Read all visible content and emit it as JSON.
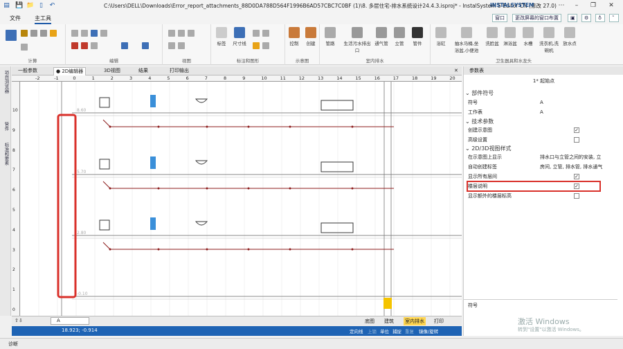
{
  "titlebar": {
    "title": "C:\\Users\\DELL\\Downloads\\Error_report_attachments_88D0DA788D564F1996B6AD57CBC7C0BF (1)\\8. 多层住宅-排水系统设计24.4.3.isproj* - InstalSystem 5 Editor CN (修改 27.0)",
    "brand": "INSTALSYSTEM"
  },
  "menubar": {
    "items": [
      "文件",
      "主工具"
    ],
    "window_btn": "窗口",
    "layout_btn": "更改屏幕的窗口布置"
  },
  "ribbon": {
    "groups": [
      "计算",
      "编辑",
      "视图",
      "标注和图形",
      "示意图",
      "室内排水",
      "卫生器具和水龙头"
    ],
    "big_buttons": [
      "标签",
      "尺寸线",
      "控制",
      "创建",
      "管路",
      "生活污水排出口",
      "通气管",
      "立管",
      "管件",
      "浴缸",
      "抽水马桶,坐浴盆,小便池",
      "洗脸盆",
      "淋浴盆",
      "水槽",
      "洗衣机,洗碗机",
      "放水点"
    ]
  },
  "leftstrip": {
    "tabs": [
      "项目浏览器",
      "管件",
      "标准和要素"
    ]
  },
  "doctabs": {
    "items": [
      "一般参数",
      "● 2D编辑器",
      "3D视图",
      "结果",
      "打印输出"
    ]
  },
  "ruler": {
    "h": [
      "-2",
      "-1",
      "0",
      "1",
      "2",
      "3",
      "4",
      "5",
      "6",
      "7",
      "8",
      "9",
      "10",
      "11",
      "12",
      "13",
      "14",
      "15",
      "16",
      "17",
      "18",
      "19",
      "20"
    ],
    "v": [
      "10",
      "9",
      "8",
      "7",
      "6",
      "5",
      "4",
      "3",
      "2",
      "1",
      "0"
    ]
  },
  "canvas": {
    "levels": [
      "8.60",
      "5.70",
      "2.80",
      "-0.10"
    ]
  },
  "canvasbar": {
    "layer": "A",
    "tabs": [
      "底图",
      "建筑",
      "室内排水",
      "打印"
    ]
  },
  "statusbar": {
    "coords": "18.923; -0.914",
    "modes": [
      "定向线",
      "上锁",
      "单位",
      "捕捉",
      "重复",
      "镜像/旋转"
    ]
  },
  "rightpanel": {
    "title": "参数表",
    "subtitle": "1* 起始点",
    "sections": [
      {
        "name": "部件符号",
        "rows": [
          {
            "label": "符号",
            "value": "A"
          },
          {
            "label": "工作表",
            "value": "A"
          }
        ]
      },
      {
        "name": "技术参数",
        "rows": [
          {
            "label": "创建示意图",
            "value": "✓"
          },
          {
            "label": "高级设置",
            "value": ""
          }
        ]
      },
      {
        "name": "2D/3D视图样式",
        "rows": [
          {
            "label": "在示意图上显示",
            "value": "排水口与立管之间的安装, 立"
          },
          {
            "label": "自动创建标签",
            "value": "房间, 立管, 排水管, 排水通气"
          },
          {
            "label": "显示所有层间",
            "value": "✓"
          },
          {
            "label": "楼层说明",
            "value": "✓"
          },
          {
            "label": "显示额外的楼层标高",
            "value": ""
          }
        ]
      }
    ],
    "footer": "符号"
  },
  "watermark": {
    "line1": "激活 Windows",
    "line2": "转到\"设置\"以激活 Windows。"
  },
  "taskbar": {
    "tab": "诊断"
  }
}
